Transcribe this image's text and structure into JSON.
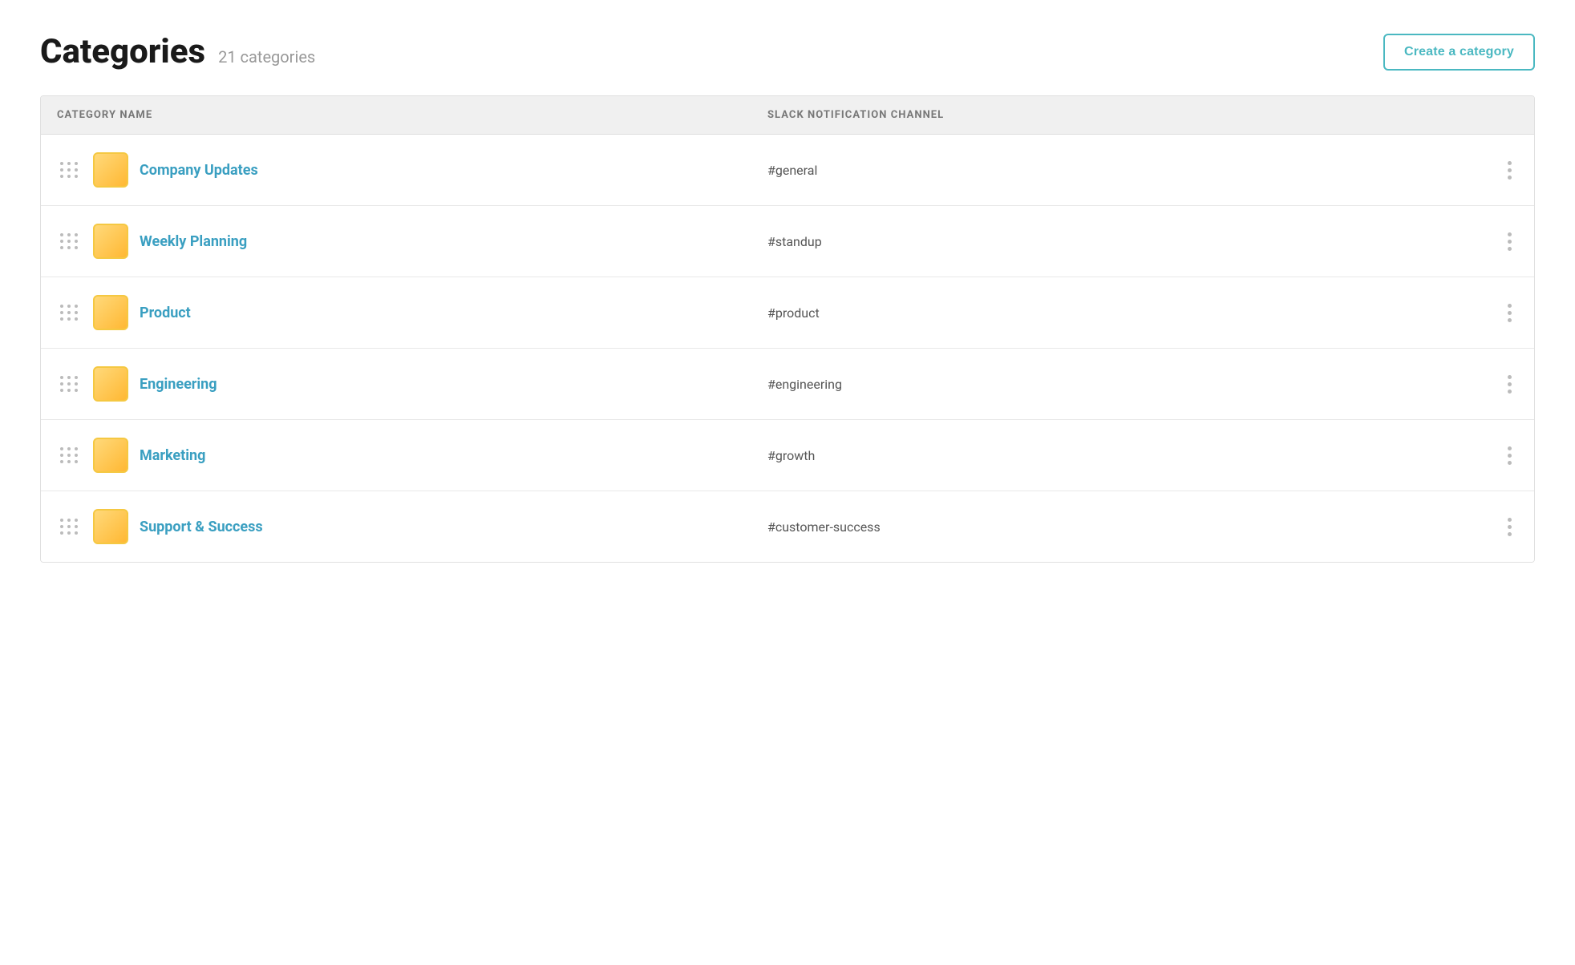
{
  "header": {
    "title": "Categories",
    "count": "21 categories",
    "create_button_label": "Create a category"
  },
  "table": {
    "columns": [
      {
        "id": "category_name",
        "label": "CATEGORY NAME"
      },
      {
        "id": "slack_channel",
        "label": "SLACK NOTIFICATION CHANNEL"
      }
    ],
    "rows": [
      {
        "id": 1,
        "name": "Company Updates",
        "slack": "#general"
      },
      {
        "id": 2,
        "name": "Weekly Planning",
        "slack": "#standup"
      },
      {
        "id": 3,
        "name": "Product",
        "slack": "#product"
      },
      {
        "id": 4,
        "name": "Engineering",
        "slack": "#engineering"
      },
      {
        "id": 5,
        "name": "Marketing",
        "slack": "#growth"
      },
      {
        "id": 6,
        "name": "Support & Success",
        "slack": "#customer-success"
      }
    ]
  },
  "colors": {
    "accent": "#4ab8c1",
    "category_link": "#3a9fc1",
    "icon_bg": "#ffd97a",
    "drag_dot": "#bbb",
    "more_dot": "#bbb"
  }
}
